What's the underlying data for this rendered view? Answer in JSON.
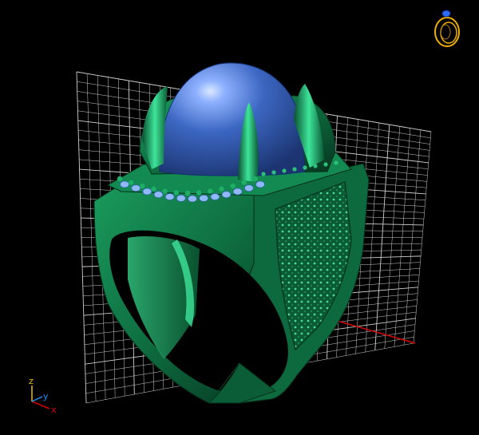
{
  "viewport": {
    "background_color": "#000000",
    "grid_color": "#cfcfcf",
    "model": {
      "metal_color": "#0f7a48",
      "metal_highlight": "#3cc98a",
      "metal_shadow": "#063a22",
      "stone_color": "#3b67c4",
      "stone_highlight": "#9ec2ff",
      "accent_stone_color": "#8fb8ff"
    },
    "axes_color_x": "#e00000",
    "axes_color_y": "#1e90ff",
    "axes_color_z": "#f0c000"
  },
  "orientation_gizmo": {
    "labels": {
      "x": "x",
      "y": "y",
      "z": "z"
    }
  },
  "view_cube_icon": {
    "name": "ring-icon",
    "color": "#f0b000",
    "stone_color": "#2e6bff"
  }
}
